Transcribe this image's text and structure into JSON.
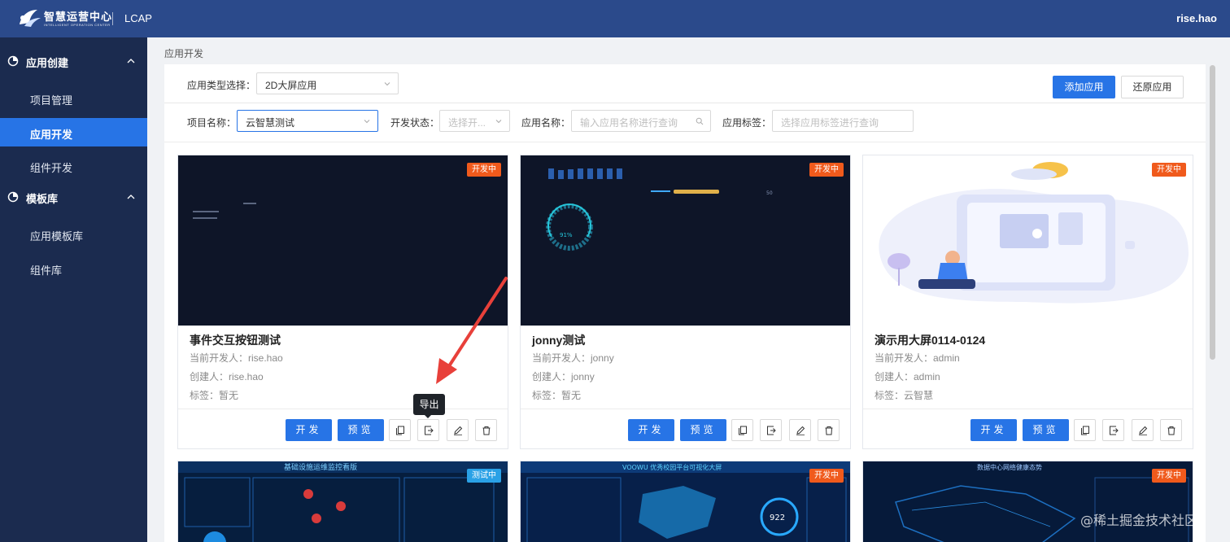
{
  "header": {
    "brand_title": "智慧运营中心",
    "brand_subtitle": "INTELLIGENT OPERATION CENTER",
    "app_name": "LCAP",
    "user": "rise.hao"
  },
  "sidebar": {
    "groups": [
      {
        "label": "应用创建",
        "items": [
          {
            "label": "项目管理"
          },
          {
            "label": "应用开发",
            "active": true
          },
          {
            "label": "组件开发"
          }
        ]
      },
      {
        "label": "模板库",
        "items": [
          {
            "label": "应用模板库"
          },
          {
            "label": "组件库"
          }
        ]
      }
    ]
  },
  "breadcrumb": "应用开发",
  "filters": {
    "app_type_label": "应用类型选择：",
    "app_type_value": "2D大屏应用",
    "project_label": "项目名称：",
    "project_value": "云智慧测试",
    "dev_status_label": "开发状态：",
    "dev_status_placeholder": "选择开...",
    "app_name_label": "应用名称：",
    "app_name_placeholder": "输入应用名称进行查询",
    "app_tag_label": "应用标签：",
    "app_tag_placeholder": "选择应用标签进行查询"
  },
  "toolbar": {
    "add_label": "添加应用",
    "restore_label": "还原应用"
  },
  "cards": [
    {
      "title": "事件交互按钮测试",
      "badge": "开发中",
      "developer": "当前开发人：rise.hao",
      "creator": "创建人：rise.hao",
      "tags": "标签：暂无"
    },
    {
      "title": "jonny测试",
      "badge": "开发中",
      "developer": "当前开发人：jonny",
      "creator": "创建人：jonny",
      "tags": "标签：暂无"
    },
    {
      "title": "演示用大屏0114-0124",
      "badge": "开发中",
      "developer": "当前开发人：admin",
      "creator": "创建人：admin",
      "tags": "标签：云智慧"
    }
  ],
  "bottom_cards": [
    {
      "badge": "测试中",
      "heading": "基础设施运维监控看版"
    },
    {
      "badge": "开发中",
      "heading": "VOOWU 优秀校园平台可视化大屏"
    },
    {
      "badge": "开发中",
      "heading": "数据中心网络健康态势"
    }
  ],
  "card_actions": {
    "develop": "开发",
    "preview": "预览"
  },
  "tooltip": "导出",
  "gauge_value": "91%",
  "gauge_number": "922",
  "progress_value": "50",
  "watermark": "@稀土掘金技术社区",
  "colors": {
    "header": "#2b4a8b",
    "sidebar": "#1b2b4f",
    "accent": "#2774e6",
    "badge_dev": "#f05a1c",
    "badge_test": "#2aa1e6",
    "arrow": "#e8403a"
  }
}
